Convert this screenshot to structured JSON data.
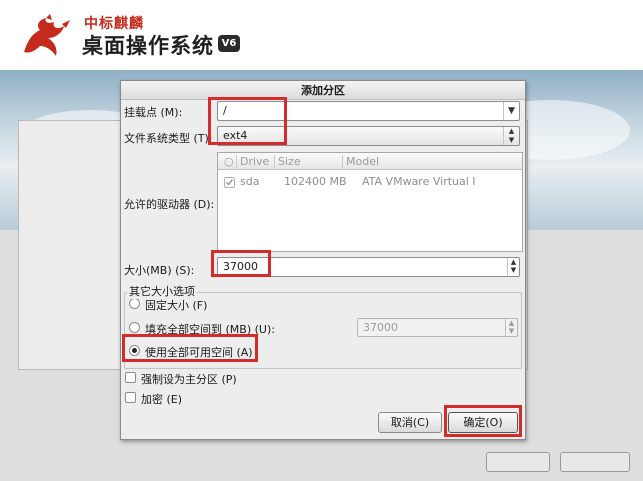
{
  "brand": {
    "company": "中标麒麟",
    "product": "桌面操作系统",
    "version_badge": "V6"
  },
  "dialog": {
    "title": "添加分区",
    "mount_point": {
      "label": "挂载点 (M):",
      "value": "/"
    },
    "fs_type": {
      "label": "文件系统类型 (T):",
      "value": "ext4"
    },
    "drives": {
      "label": "允许的驱动器 (D):",
      "columns": [
        "Drive",
        "Size",
        "Model"
      ],
      "rows": [
        {
          "checked": true,
          "drive": "sda",
          "size": "102400 MB",
          "model": "ATA VMware Virtual I"
        }
      ]
    },
    "size": {
      "label": "大小(MB) (S):",
      "value": "37000"
    },
    "size_options": {
      "group_label": "其它大小选项",
      "fixed_label": "固定大小 (F)",
      "fill_to_label": "填充全部空间到 (MB) (U):",
      "fill_to_value": "37000",
      "fill_all_label": "使用全部可用空间 (A)",
      "selected": "fill_all"
    },
    "primary_label": "强制设为主分区 (P)",
    "encrypt_label": "加密 (E)",
    "cancel_label": "取消(C)",
    "ok_label": "确定(O)"
  },
  "colors": {
    "highlight": "#d42b2b",
    "brand_red": "#c42b1c"
  }
}
